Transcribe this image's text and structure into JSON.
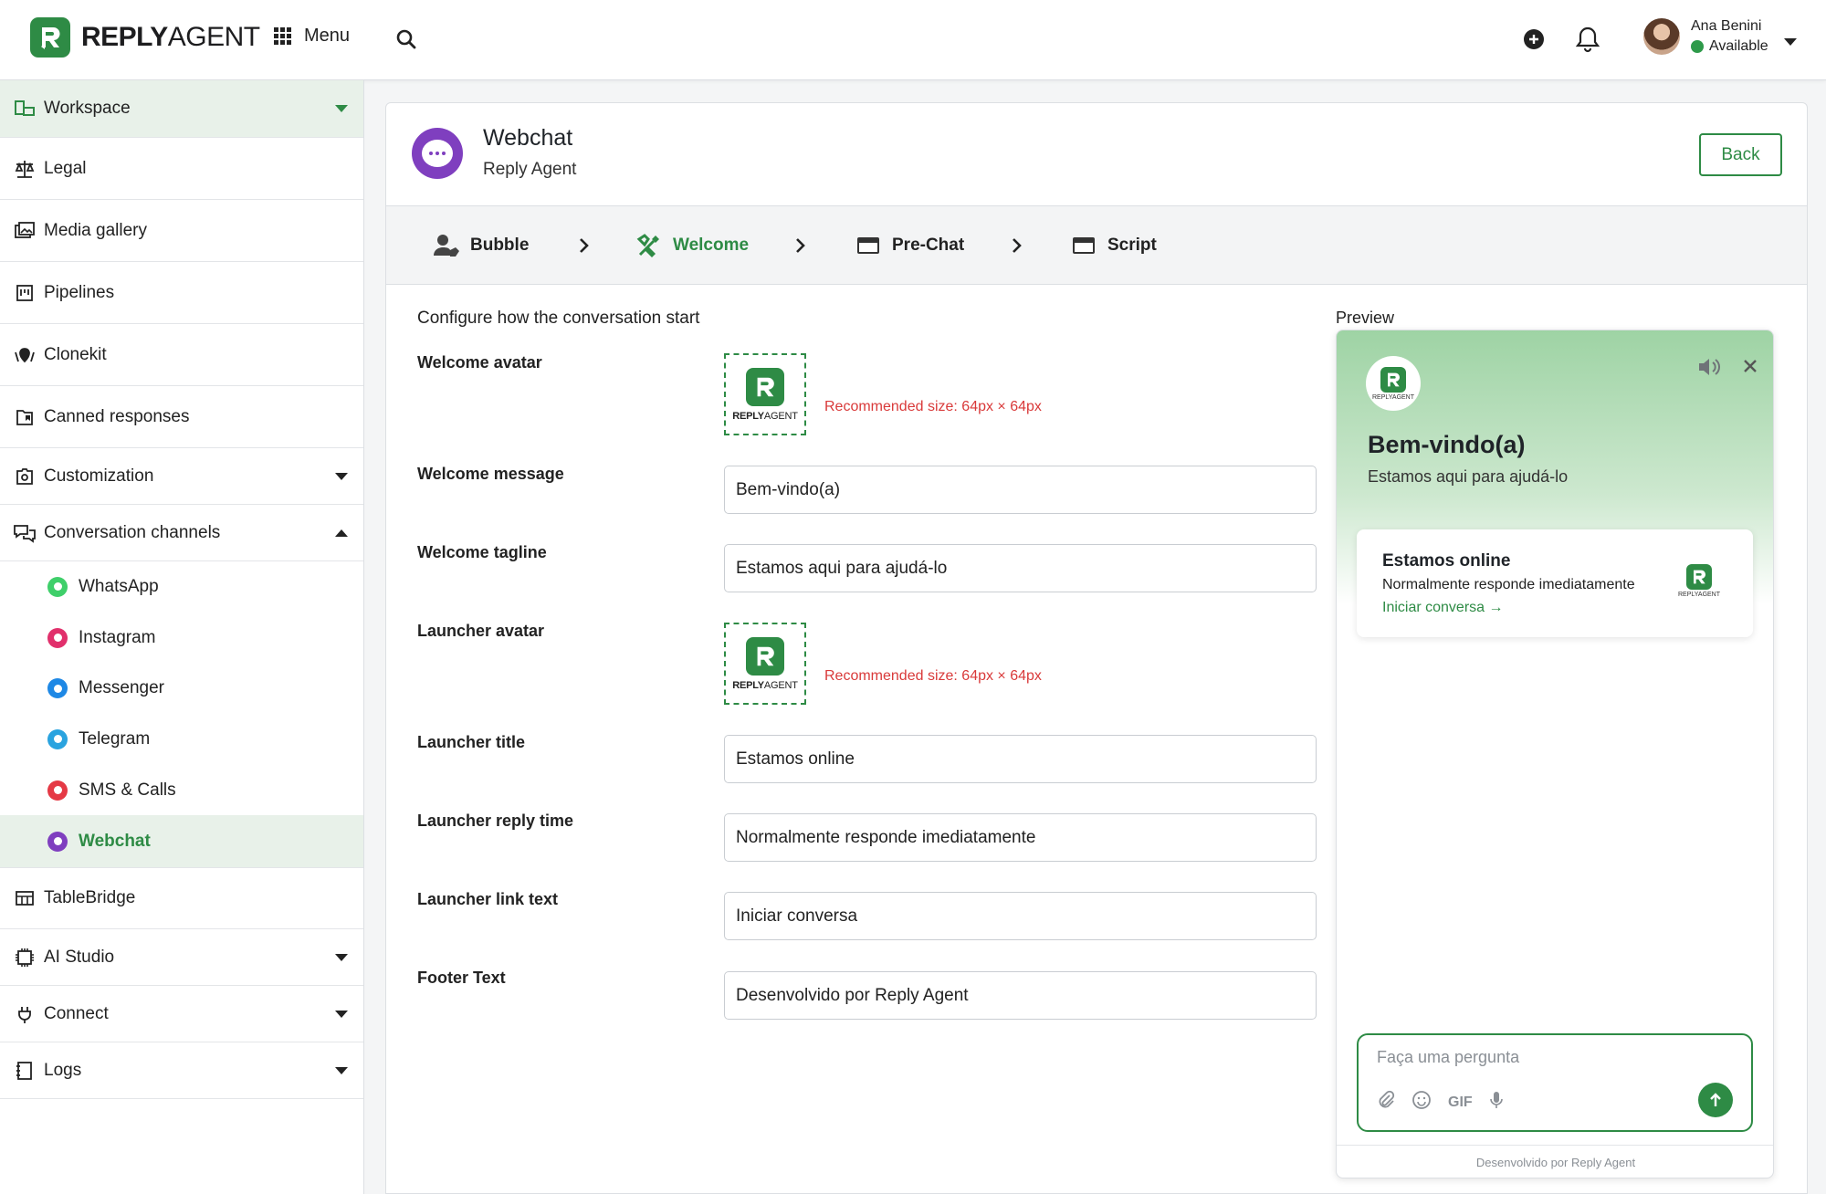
{
  "app": {
    "logo_bold": "REPLY",
    "logo_light": "AGENT",
    "menu_label": "Menu"
  },
  "user": {
    "name": "Ana Benini",
    "status": "Available"
  },
  "sidebar": {
    "workspace": "Workspace",
    "items": [
      {
        "label": "Legal",
        "icon": "scale-icon"
      },
      {
        "label": "Media gallery",
        "icon": "gallery-icon"
      },
      {
        "label": "Pipelines",
        "icon": "pipeline-icon"
      },
      {
        "label": "Clonekit",
        "icon": "clonekit-icon"
      },
      {
        "label": "Canned responses",
        "icon": "canned-icon"
      },
      {
        "label": "Customization",
        "icon": "customization-icon"
      },
      {
        "label": "Conversation channels",
        "icon": "chat-channels-icon"
      }
    ],
    "channels": [
      {
        "label": "WhatsApp",
        "color": "#3fcf6a"
      },
      {
        "label": "Instagram",
        "color": "#e1306c"
      },
      {
        "label": "Messenger",
        "color": "#1e88e5"
      },
      {
        "label": "Telegram",
        "color": "#2aa3df"
      },
      {
        "label": "SMS & Calls",
        "color": "#e53945"
      },
      {
        "label": "Webchat",
        "color": "#7f3fbf"
      }
    ],
    "bottom": [
      {
        "label": "TableBridge"
      },
      {
        "label": "AI Studio"
      },
      {
        "label": "Connect"
      },
      {
        "label": "Logs"
      }
    ]
  },
  "page": {
    "title": "Webchat",
    "subtitle": "Reply Agent",
    "back_label": "Back",
    "steps": [
      "Bubble",
      "Welcome",
      "Pre-Chat",
      "Script"
    ],
    "intro": "Configure how the conversation start"
  },
  "form": {
    "welcome_avatar_label": "Welcome avatar",
    "rec_size": "Recommended size: 64px × 64px",
    "welcome_message_label": "Welcome message",
    "welcome_message": "Bem-vindo(a)",
    "welcome_tagline_label": "Welcome tagline",
    "welcome_tagline": "Estamos aqui para ajudá-lo",
    "launcher_avatar_label": "Launcher avatar",
    "launcher_title_label": "Launcher title",
    "launcher_title": "Estamos online",
    "launcher_reply_label": "Launcher reply time",
    "launcher_reply": "Normalmente responde imediatamente",
    "launcher_link_label": "Launcher link text",
    "launcher_link": "Iniciar conversa",
    "footer_label": "Footer Text",
    "footer": "Desenvolvido por Reply Agent"
  },
  "preview": {
    "label": "Preview",
    "logo_text": "REPLYAGENT",
    "title": "Bem-vindo(a)",
    "tagline": "Estamos aqui para ajudá-lo",
    "launcher_title": "Estamos online",
    "launcher_reply": "Normalmente responde imediatamente",
    "launcher_link": "Iniciar conversa →",
    "placeholder": "Faça uma pergunta",
    "gif": "GIF",
    "footer": "Desenvolvido por Reply Agent"
  },
  "colors": {
    "brand": "#2e8b45",
    "webchat": "#7f3fbf",
    "warning": "#d93a3a"
  }
}
